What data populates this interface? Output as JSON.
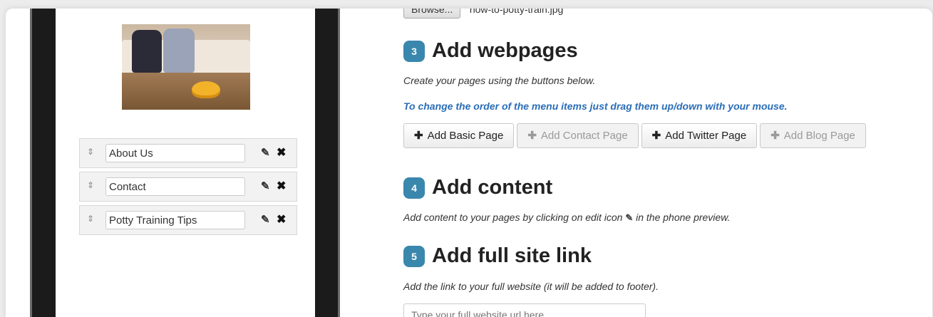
{
  "phone_preview": {
    "menu_items": [
      {
        "label": "About Us"
      },
      {
        "label": "Contact"
      },
      {
        "label": "Potty Training Tips"
      }
    ]
  },
  "upload": {
    "browse_label": "Browse...",
    "file_name": "how-to-potty-train.jpg"
  },
  "step3": {
    "number": "3",
    "title": "Add webpages",
    "description": "Create your pages using the buttons below.",
    "drag_note": "To change the order of the menu items just drag them up/down with your mouse.",
    "buttons": [
      {
        "label": "Add Basic Page",
        "enabled": true
      },
      {
        "label": "Add Contact Page",
        "enabled": false
      },
      {
        "label": "Add Twitter Page",
        "enabled": true
      },
      {
        "label": "Add Blog Page",
        "enabled": false
      }
    ]
  },
  "step4": {
    "number": "4",
    "title": "Add content",
    "description_before": "Add content to your pages by clicking on edit icon",
    "description_after": "in the phone preview."
  },
  "step5": {
    "number": "5",
    "title": "Add full site link",
    "description": "Add the link to your full website (it will be added to footer).",
    "url_placeholder": "Type your full website url here"
  },
  "colors": {
    "step_badge": "#3a87ad",
    "note_link": "#2a6db7",
    "potty": "#f2b32a"
  },
  "icons": {
    "drag": "drag-handle-icon",
    "edit": "edit-icon",
    "delete": "delete-icon",
    "plus": "plus-icon"
  }
}
